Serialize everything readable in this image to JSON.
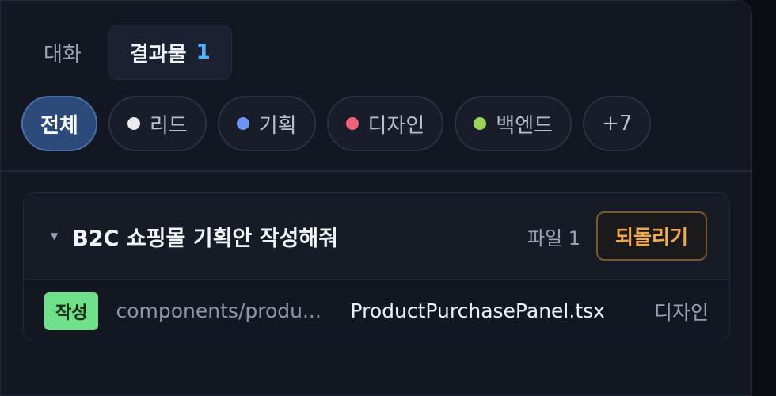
{
  "tabs": [
    {
      "label": "대화",
      "active": false
    },
    {
      "label": "결과물",
      "count": "1",
      "active": true
    }
  ],
  "filters": [
    {
      "label": "전체",
      "active": true
    },
    {
      "label": "리드",
      "dot_color": "#e9ebf0"
    },
    {
      "label": "기획",
      "dot_color": "#6f93f2"
    },
    {
      "label": "디자인",
      "dot_color": "#f0607a"
    },
    {
      "label": "백엔드",
      "dot_color": "#9bd35a"
    },
    {
      "label": "+7"
    }
  ],
  "card": {
    "title": "B2C 쇼핑몰 기획안 작성해줘",
    "file_count": "파일 1",
    "revert_label": "되돌리기",
    "files": [
      {
        "badge": "작성",
        "path": "components/produ...",
        "name": "ProductPurchasePanel.tsx",
        "role": "디자인"
      }
    ]
  }
}
